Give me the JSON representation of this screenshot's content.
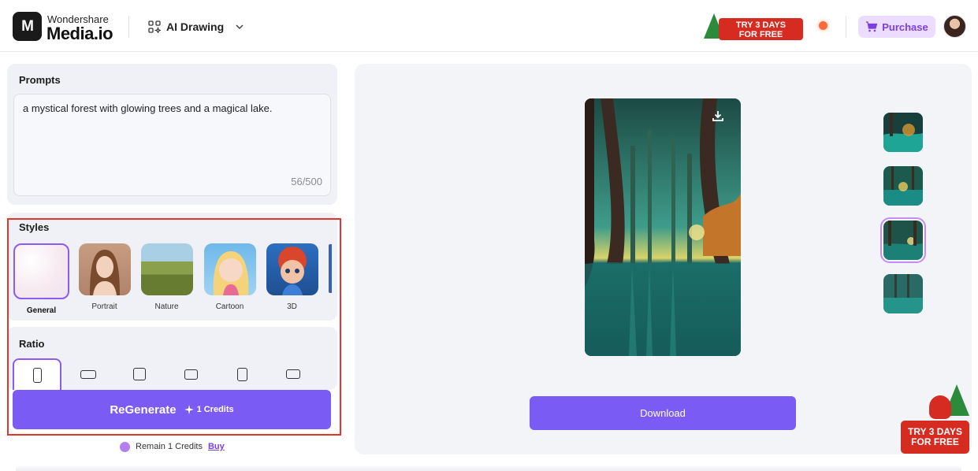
{
  "header": {
    "logo_mark": "M",
    "brand_top": "Wondershare",
    "brand_main": "Media.io",
    "tool_switch_label": "AI Drawing",
    "promo_line1": "TRY 3 DAYS",
    "promo_line2": "FOR FREE",
    "purchase_label": "Purchase"
  },
  "prompts": {
    "title": "Prompts",
    "text": "a mystical forest with glowing trees and a magical lake.",
    "count": "56/500"
  },
  "styles": {
    "title": "Styles",
    "items": [
      {
        "label": "General",
        "selected": true
      },
      {
        "label": "Portrait",
        "selected": false
      },
      {
        "label": "Nature",
        "selected": false
      },
      {
        "label": "Cartoon",
        "selected": false
      },
      {
        "label": "3D",
        "selected": false
      }
    ]
  },
  "ratio": {
    "title": "Ratio"
  },
  "regenerate": {
    "label": "ReGenerate",
    "credits": "1 Credits"
  },
  "remain": {
    "text": "Remain 1 Credits",
    "buy": "Buy"
  },
  "preview": {
    "download_label": "Download",
    "promo_line1": "TRY 3 DAYS",
    "promo_line2": "FOR FREE"
  },
  "colors": {
    "accent": "#7a5cf5",
    "selection": "#8a5cf5",
    "highlight": "#e0362c",
    "promo_red": "#d62b20"
  }
}
